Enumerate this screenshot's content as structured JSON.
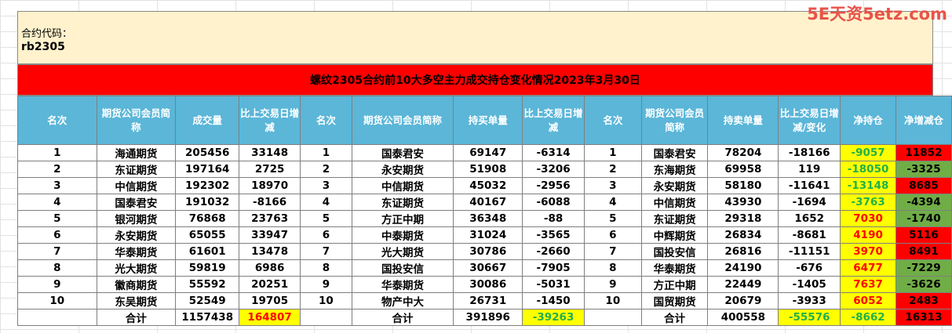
{
  "watermark": "5E天资5etz.com",
  "contract": {
    "label": "合约代码：",
    "code": "rb2305"
  },
  "title": "螺纹2305合约前10大多空主力成交持仓变化情况2023年3月30日",
  "headers": [
    "名次",
    "期货公司会员简称",
    "成交量",
    "比上交易日增减",
    "名次",
    "期货公司会员简称",
    "持买单量",
    "比上交易日增减",
    "名次",
    "期货公司会员简称",
    "持卖单量",
    "比上交易日增减/变化",
    "净持仓",
    "净增减仓"
  ],
  "rows": [
    [
      "1",
      "海通期货",
      "205456",
      "33148",
      "1",
      "国泰君安",
      "69147",
      "-6314",
      "1",
      "国泰君安",
      "78204",
      "-18166",
      "-9057",
      "11852"
    ],
    [
      "2",
      "东证期货",
      "197164",
      "2725",
      "2",
      "永安期货",
      "51908",
      "-3206",
      "2",
      "东海期货",
      "69958",
      "119",
      "-18050",
      "-3325"
    ],
    [
      "3",
      "中信期货",
      "192302",
      "18970",
      "3",
      "中信期货",
      "45032",
      "-2956",
      "3",
      "永安期货",
      "58180",
      "-11641",
      "-13148",
      "8685"
    ],
    [
      "4",
      "国泰君安",
      "191032",
      "-8166",
      "4",
      "东证期货",
      "40167",
      "-6088",
      "4",
      "中信期货",
      "43930",
      "-1694",
      "-3763",
      "-4394"
    ],
    [
      "5",
      "银河期货",
      "76868",
      "23763",
      "5",
      "方正中期",
      "36348",
      "-88",
      "5",
      "东证期货",
      "29318",
      "1652",
      "7030",
      "-1740"
    ],
    [
      "6",
      "永安期货",
      "65055",
      "33947",
      "6",
      "中泰期货",
      "31024",
      "-3565",
      "6",
      "中辉期货",
      "26834",
      "-8681",
      "4190",
      "5116"
    ],
    [
      "7",
      "华泰期货",
      "61601",
      "13478",
      "7",
      "光大期货",
      "30786",
      "-2660",
      "7",
      "国投安信",
      "26816",
      "-11151",
      "3970",
      "8491"
    ],
    [
      "8",
      "光大期货",
      "59819",
      "6986",
      "8",
      "国投安信",
      "30667",
      "-7905",
      "8",
      "华泰期货",
      "24190",
      "-676",
      "6477",
      "-7229"
    ],
    [
      "9",
      "徽商期货",
      "55592",
      "20251",
      "9",
      "华泰期货",
      "30086",
      "-5031",
      "9",
      "方正中期",
      "22449",
      "-1405",
      "7637",
      "-3626"
    ],
    [
      "10",
      "东吴期货",
      "52549",
      "19705",
      "10",
      "物产中大",
      "26731",
      "-1450",
      "10",
      "国贸期货",
      "20679",
      "-3933",
      "6052",
      "2483"
    ]
  ],
  "totals": [
    "",
    "合计",
    "1157438",
    "164807",
    "",
    "合计",
    "391896",
    "-39263",
    "",
    "合计",
    "400558",
    "-55576",
    "-8662",
    "16313"
  ],
  "colors": {
    "header_bg": "#5bb6d8",
    "banner_bg": "#ff0000",
    "info_bg": "#fff2cc",
    "highlight": "#ffff00",
    "up": "#ff0000",
    "down": "#70ad47"
  }
}
